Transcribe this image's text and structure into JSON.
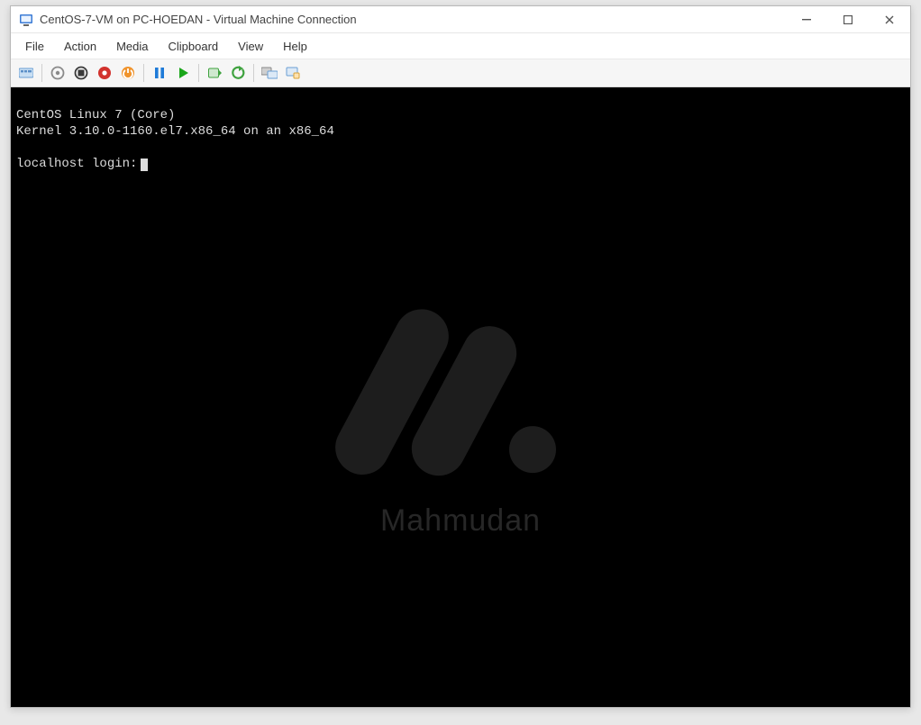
{
  "window": {
    "title": "CentOS-7-VM on PC-HOEDAN - Virtual Machine Connection"
  },
  "menu": {
    "items": [
      "File",
      "Action",
      "Media",
      "Clipboard",
      "View",
      "Help"
    ]
  },
  "toolbar": {
    "buttons": [
      {
        "name": "ctrl-alt-del-button",
        "icon": "ctrl-alt-del-icon"
      },
      {
        "sep": true
      },
      {
        "name": "turn-off-button",
        "icon": "turn-off-icon"
      },
      {
        "name": "shut-down-button",
        "icon": "shut-down-icon"
      },
      {
        "name": "save-button",
        "icon": "save-icon"
      },
      {
        "name": "reset-button",
        "icon": "reset-icon"
      },
      {
        "sep": true
      },
      {
        "name": "pause-button",
        "icon": "pause-icon"
      },
      {
        "name": "start-button",
        "icon": "start-icon"
      },
      {
        "sep": true
      },
      {
        "name": "checkpoint-button",
        "icon": "checkpoint-icon"
      },
      {
        "name": "revert-button",
        "icon": "revert-icon"
      },
      {
        "sep": true
      },
      {
        "name": "enhanced-session-button",
        "icon": "enhanced-session-icon"
      },
      {
        "name": "share-button",
        "icon": "share-icon"
      }
    ]
  },
  "console": {
    "line1": "CentOS Linux 7 (Core)",
    "line2": "Kernel 3.10.0-1160.el7.x86_64 on an x86_64",
    "prompt": "localhost login:"
  },
  "watermark": {
    "text": "Mahmudan"
  }
}
